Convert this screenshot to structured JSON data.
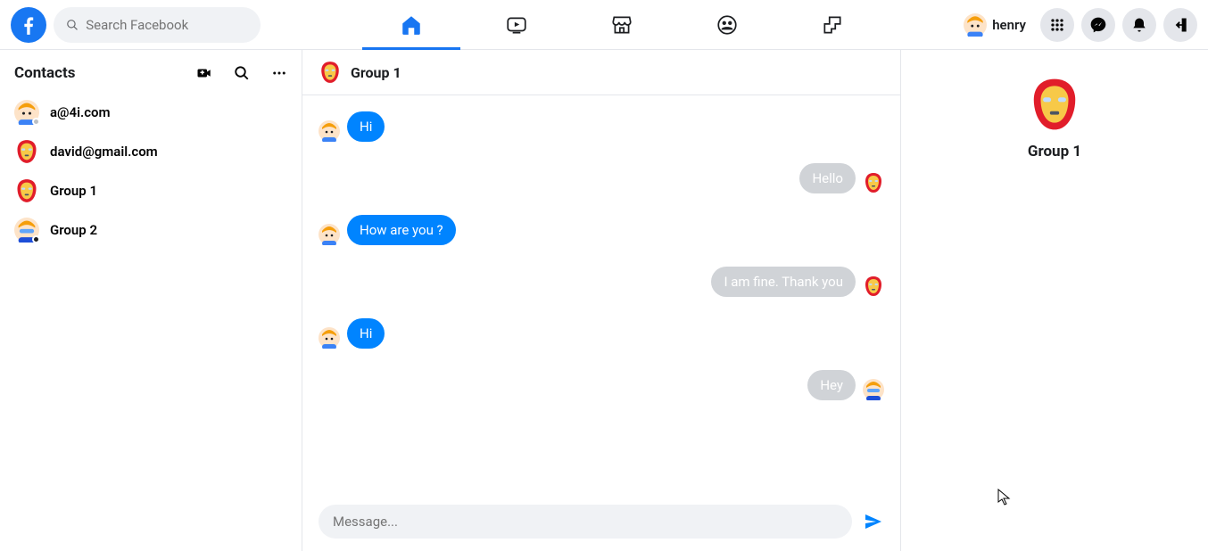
{
  "header": {
    "search_placeholder": "Search Facebook",
    "username": "henry"
  },
  "sidebar": {
    "title": "Contacts",
    "items": [
      {
        "name": "a@4i.com",
        "avatar": "person1",
        "status": "offline"
      },
      {
        "name": "david@gmail.com",
        "avatar": "ironman",
        "status": "none"
      },
      {
        "name": "Group 1",
        "avatar": "ironman",
        "status": "none"
      },
      {
        "name": "Group 2",
        "avatar": "person2",
        "status": "dark"
      }
    ]
  },
  "chat": {
    "title": "Group 1",
    "avatar": "ironman",
    "messages": [
      {
        "side": "left",
        "avatar": "person1",
        "text": "Hi",
        "style": "blue"
      },
      {
        "side": "right",
        "avatar": "ironman",
        "text": "Hello",
        "style": "gray"
      },
      {
        "side": "left",
        "avatar": "person1",
        "text": "How are you ?",
        "style": "blue"
      },
      {
        "side": "right",
        "avatar": "ironman",
        "text": "I am fine. Thank you",
        "style": "gray"
      },
      {
        "side": "left",
        "avatar": "person1",
        "text": "Hi",
        "style": "blue"
      },
      {
        "side": "right",
        "avatar": "person2",
        "text": "Hey",
        "style": "gray"
      }
    ],
    "composer_placeholder": "Message..."
  },
  "info": {
    "title": "Group 1",
    "avatar": "ironman"
  }
}
